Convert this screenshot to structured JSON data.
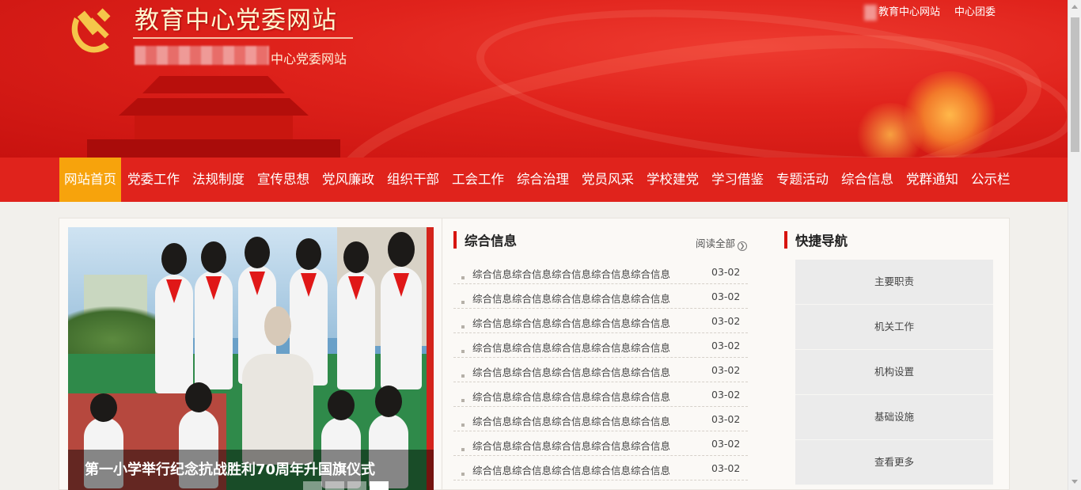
{
  "header": {
    "site_title": "教育中心党委网站",
    "site_subtitle": "中心党委网站",
    "toplinks": [
      "教育中心网站",
      "中心团委"
    ]
  },
  "nav": {
    "items": [
      "网站首页",
      "党委工作",
      "法规制度",
      "宣传思想",
      "党风廉政",
      "组织干部",
      "工会工作",
      "综合治理",
      "党员风采",
      "学校建党",
      "学习借鉴",
      "专题活动",
      "综合信息",
      "党群通知",
      "公示栏"
    ],
    "active_index": 0
  },
  "slider": {
    "caption": "第一小学举行纪念抗战胜利70周年升国旗仪式",
    "slides_count": 4,
    "active_slide": 3
  },
  "news": {
    "title": "综合信息",
    "more_label": "阅读全部",
    "items": [
      {
        "text": "综合信息综合信息综合信息综合信息综合信息",
        "date": "03-02"
      },
      {
        "text": "综合信息综合信息综合信息综合信息综合信息",
        "date": "03-02"
      },
      {
        "text": "综合信息综合信息综合信息综合信息综合信息",
        "date": "03-02"
      },
      {
        "text": "综合信息综合信息综合信息综合信息综合信息",
        "date": "03-02"
      },
      {
        "text": "综合信息综合信息综合信息综合信息综合信息",
        "date": "03-02"
      },
      {
        "text": "综合信息综合信息综合信息综合信息综合信息",
        "date": "03-02"
      },
      {
        "text": "综合信息综合信息综合信息综合信息综合信息",
        "date": "03-02"
      },
      {
        "text": "综合信息综合信息综合信息综合信息综合信息",
        "date": "03-02"
      },
      {
        "text": "综合信息综合信息综合信息综合信息综合信息",
        "date": "03-02"
      }
    ]
  },
  "quicknav": {
    "title": "快捷导航",
    "items": [
      "主要职责",
      "机关工作",
      "机构设置",
      "基础设施",
      "查看更多"
    ]
  },
  "colors": {
    "primary_red": "#e0231c",
    "nav_active": "#f7a30c",
    "accent_bar": "#d7140f"
  }
}
